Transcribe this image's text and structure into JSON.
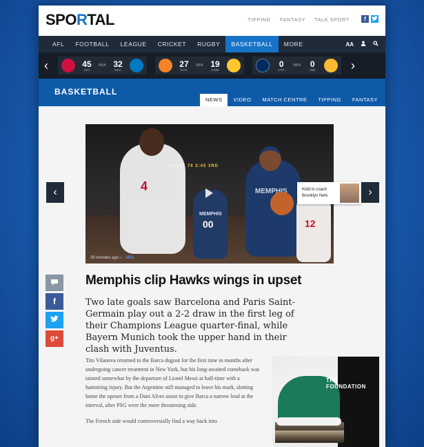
{
  "brand": {
    "logo": "SPORTAL"
  },
  "top_links": [
    "TIPPING",
    "FANTASY",
    "TALK SPORT"
  ],
  "social_top": {
    "facebook": "f",
    "twitter": "t"
  },
  "nav": {
    "items": [
      "AFL",
      "FOOTBALL",
      "LEAGUE",
      "CRICKET",
      "RUGBY",
      "BASKETBALL",
      "MORE"
    ],
    "active": "BASKETBALL",
    "tools": [
      "AA",
      "user-icon",
      "search-icon"
    ]
  },
  "scores": [
    {
      "home": "CHI",
      "home_score": "45",
      "league": "NBA",
      "away": "OKC",
      "away_score": "32",
      "home_color": "#ce1141",
      "away_color": "#007ac1"
    },
    {
      "home": "NYK",
      "home_score": "27",
      "league": "NBA",
      "away": "GSW",
      "away_score": "19",
      "home_color": "#f58426",
      "away_color": "#ffc72c"
    },
    {
      "home": "UTA",
      "home_score": "0",
      "league": "NBA",
      "away": "IND",
      "away_score": "0",
      "home_color": "#002b5c",
      "away_color": "#fdbb30"
    }
  ],
  "section": {
    "title": "BASKETBALL",
    "tabs": [
      "NEWS",
      "VIDEO",
      "MATCH CENTRE",
      "TIPPING",
      "FANTASY"
    ],
    "active_tab": "NEWS"
  },
  "hero": {
    "timestamp": "30 minutes ago",
    "league_tag": "NBA",
    "scoreboard": "HAWKS 76 2:45 3RD",
    "player_texts": {
      "p1_number": "4",
      "p2_name": "MEMPHIS",
      "p3_name": "MEMPHIS",
      "p3_number": "00",
      "p4_number": "12"
    }
  },
  "teaser": {
    "title": "Kidd to coach Brooklyn Nets"
  },
  "share": {
    "comment": "comment-icon",
    "facebook": "f",
    "twitter": "twitter-icon",
    "google": "g+"
  },
  "article": {
    "headline": "Memphis clip Hawks wings in upset",
    "lead": "Two late goals saw Barcelona and Paris Saint-Germain play out a 2-2 draw in the first leg of their Champions League quarter-final, while Bayern Munich took the upper hand in their clash with Juventus.",
    "paragraphs": [
      "Tito Vilanova returned to the Barca dugout for the first time in months after undergoing cancer treatment in New York, but his long-awaited comeback was tainted somewhat by the departure of Lionel Messi at half-time with a hamstring injury. But the Argentine still managed to leave his mark, slotting home the opener from a Dani Alves assist to give Barca a narrow lead at the interval, after PSG were the more threatening side.",
      "The French side would controversially find a way back into"
    ]
  },
  "ad": {
    "headline": "THE FOUNDATION"
  }
}
